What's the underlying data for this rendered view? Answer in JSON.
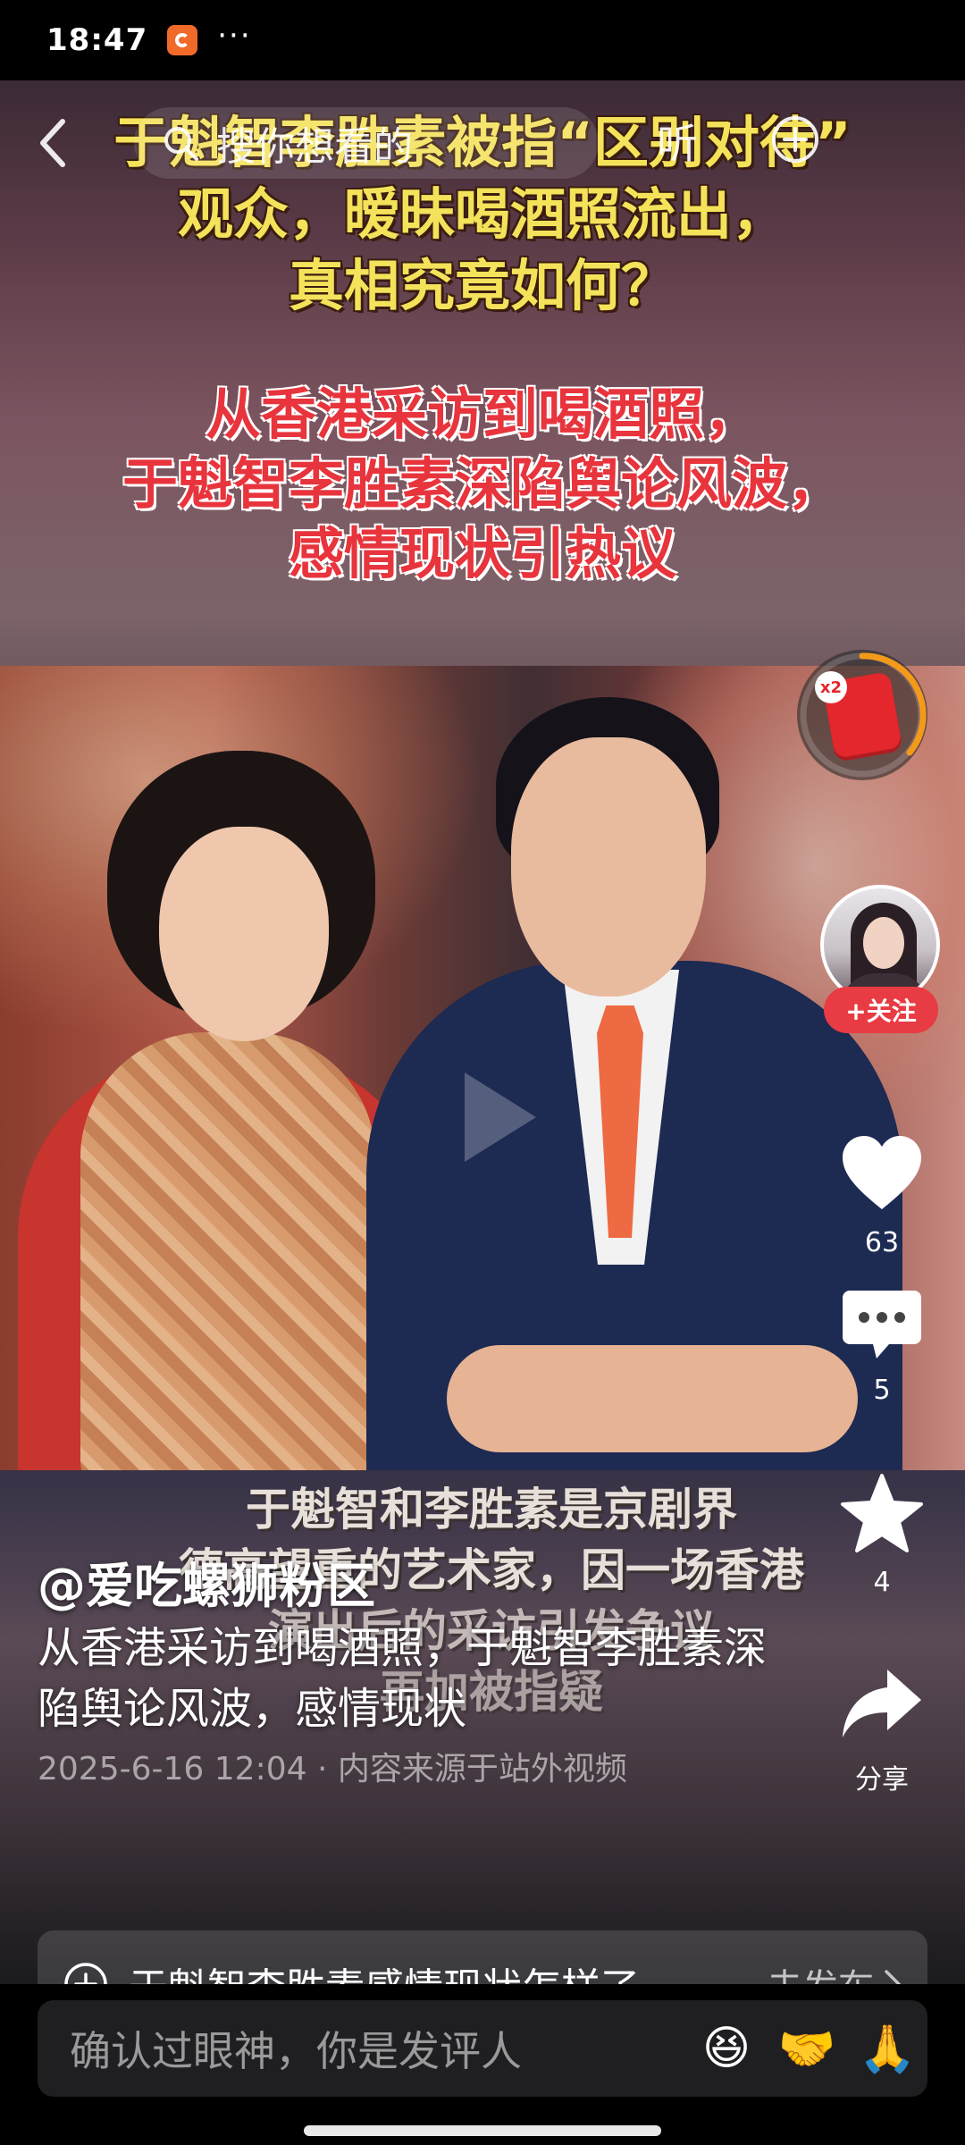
{
  "status_bar": {
    "time": "18:47",
    "dots": "···"
  },
  "video": {
    "headline_yellow": [
      "于魁智李胜素被指“区别对待”",
      "观众，暧昧喝酒照流出，",
      "真相究竟如何？"
    ],
    "headline_red": [
      "从香港采访到喝酒照，",
      "于魁智李胜素深陷舆论风波，",
      "感情现状引热议"
    ],
    "subtitles": [
      "于魁智和李胜素是京剧界",
      "德高望重的艺术家，因一场香港",
      "演出后的采访引发争议",
      "再加被指疑"
    ]
  },
  "search": {
    "placeholder": "搜你想看的",
    "listen_label": "听"
  },
  "right_rail": {
    "redpacket_badge": "x2",
    "follow_label": "+关注",
    "like_count": "63",
    "comment_count": "5",
    "favorite_count": "4",
    "share_label": "分享"
  },
  "post": {
    "author": "@爱吃螺狮粉区",
    "caption": "从香港采访到喝酒照，于魁智李胜素深陷舆论风波，感情现状",
    "meta": "2025-6-16 12:04 · 内容来源于站外视频"
  },
  "topic_bar": {
    "text": "于魁智李胜素感情现状怎样了",
    "action": "去发布"
  },
  "progress": {
    "played_fraction": 0.1
  },
  "comment_bar": {
    "placeholder": "确认过眼神，你是发评人",
    "emojis": [
      "😆",
      "🤝",
      "🙏"
    ]
  }
}
